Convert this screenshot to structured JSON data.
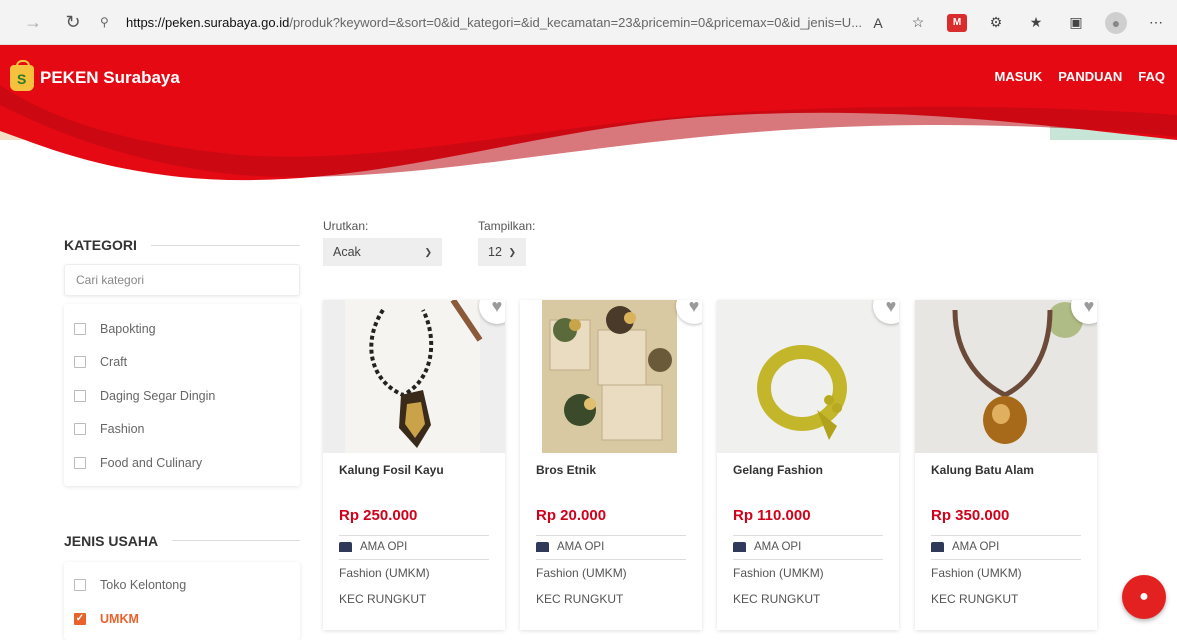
{
  "browser": {
    "url_host": "https://peken.surabaya.go.id",
    "url_rest": "/produk?keyword=&sort=0&id_kategori=&id_kecamatan=23&pricemin=0&pricemax=0&id_jenis=U...",
    "icons": [
      "back-icon",
      "reload-icon",
      "lock-icon",
      "read-aloud-icon",
      "add-favorite-icon",
      "extension-icon",
      "extensions-puzzle-icon",
      "favorites-icon",
      "collections-icon",
      "profile-icon",
      "more-icon"
    ]
  },
  "site": {
    "brand": "PEKEN Surabaya",
    "nav": [
      "MASUK",
      "PANDUAN",
      "FAQ"
    ],
    "colors": {
      "primary": "#e50914",
      "accent": "#e8622c",
      "price": "#d0021b"
    }
  },
  "sidebar": {
    "kategori_title": "KATEGORI",
    "search_placeholder": "Cari kategori",
    "categories": [
      "Bapokting",
      "Craft",
      "Daging Segar Dingin",
      "Fashion",
      "Food and Culinary"
    ],
    "jenis_title": "JENIS USAHA",
    "jenis": [
      {
        "label": "Toko Kelontong",
        "checked": false
      },
      {
        "label": "UMKM",
        "checked": true
      }
    ]
  },
  "controls": {
    "sort_label": "Urutkan:",
    "sort_value": "Acak",
    "show_label": "Tampilkan:",
    "show_value": "12"
  },
  "products": [
    {
      "name": "Kalung Fosil Kayu",
      "price": "Rp 250.000",
      "store": "AMA OPI",
      "category": "Fashion (UMKM)",
      "kecamatan": "KEC RUNGKUT"
    },
    {
      "name": "Bros Etnik",
      "price": "Rp 20.000",
      "store": "AMA OPI",
      "category": "Fashion (UMKM)",
      "kecamatan": "KEC RUNGKUT"
    },
    {
      "name": "Gelang Fashion",
      "price": "Rp 110.000",
      "store": "AMA OPI",
      "category": "Fashion (UMKM)",
      "kecamatan": "KEC RUNGKUT"
    },
    {
      "name": "Kalung Batu Alam",
      "price": "Rp 350.000",
      "store": "AMA OPI",
      "category": "Fashion (UMKM)",
      "kecamatan": "KEC RUNGKUT"
    }
  ]
}
